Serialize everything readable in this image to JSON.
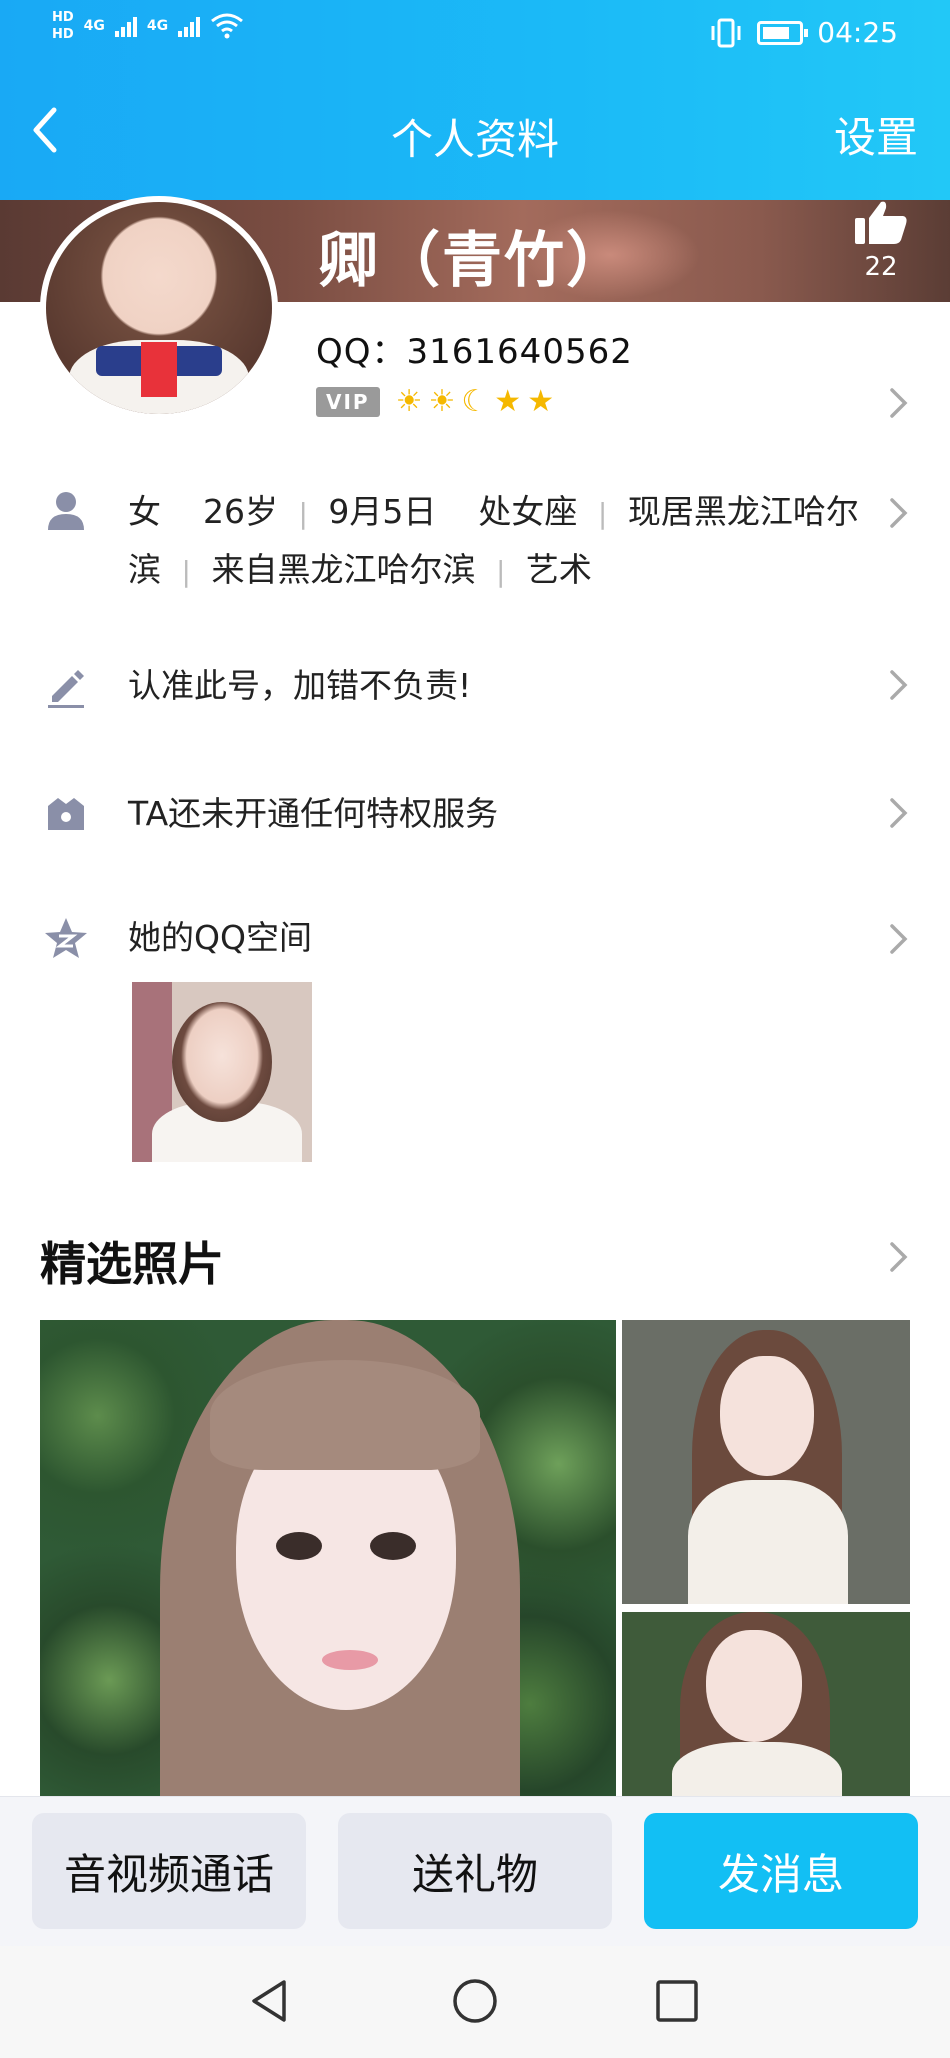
{
  "status_bar": {
    "hd1": "HD",
    "hd2": "HD",
    "net1": "4G",
    "net2": "4G",
    "time": "04:25"
  },
  "nav": {
    "title": "个人资料",
    "settings_label": "设置"
  },
  "profile": {
    "nickname": "卿（青竹）",
    "like_count": "22",
    "qq_number": "QQ：3161640562",
    "vip_label": "VIP",
    "level_icons": [
      "sun-icon",
      "sun-icon",
      "moon-icon",
      "star-icon",
      "star-icon"
    ],
    "level_glyphs": [
      "☀",
      "☀",
      "☾",
      "★",
      "★"
    ]
  },
  "info": {
    "gender": "女",
    "age": "26岁",
    "birthday": "9月5日",
    "zodiac": "处女座",
    "location_part1": "现居黑龙江哈尔",
    "location_part2": "滨",
    "hometown": "来自黑龙江哈尔滨",
    "occupation": "艺术",
    "signature": "认准此号，加错不负责!",
    "privilege": "TA还未开通任何特权服务",
    "qzone": "她的QQ空间"
  },
  "photos": {
    "section_title": "精选照片"
  },
  "actions": {
    "call_label": "音视频通话",
    "gift_label": "送礼物",
    "message_label": "发消息"
  },
  "colors": {
    "header_blue": "#19a9f5",
    "primary_button": "#12bff4",
    "secondary_button": "#e6e8f0",
    "icon_grey": "#8a8fa8"
  }
}
